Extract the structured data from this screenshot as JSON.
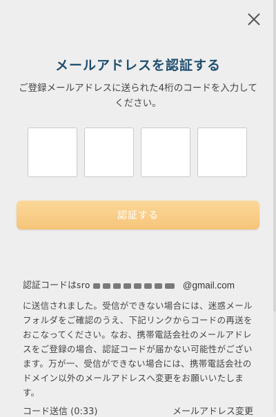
{
  "modal": {
    "title": "メールアドレスを認証する",
    "instruction": "ご登録メールアドレスに送られた4桁のコードを入力してください。",
    "code_inputs": [
      "",
      "",
      "",
      ""
    ],
    "verify_button_label": "認証する"
  },
  "status": {
    "sent_prefix": "認証コードは",
    "email_masked_visible": "sro",
    "email_domain": "@gmail.com",
    "notice": "に送信されました。受信ができない場合には、迷惑メールフォルダをご確認のうえ、下記リンクからコードの再送をおこなってください。なお、携帯電話会社のメールアドレスをご登録の場合、認証コードが届かない可能性がございます。万が一、受信ができない場合には、携帯電話会社のドメイン以外のメールアドレスへ変更をお願いいたします。"
  },
  "links": {
    "resend": "コード送信 (0:33)",
    "change_email": "メールアドレス変更"
  },
  "colors": {
    "title": "#1e4d6f",
    "button": "#f6c47a",
    "background": "#eeeeee"
  },
  "icons": {
    "close": "close-icon"
  }
}
